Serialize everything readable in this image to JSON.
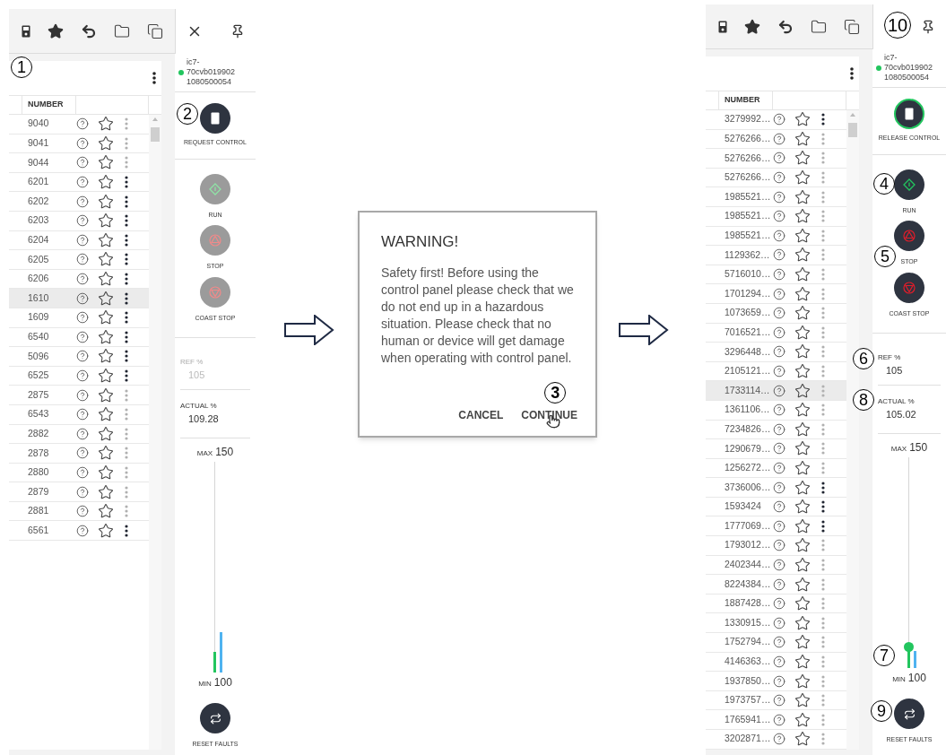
{
  "screens": [
    {
      "toolbar": {
        "callout": "1"
      },
      "device": {
        "lines": [
          "ic7-",
          "70cvb019902",
          "1080500054"
        ]
      },
      "control": {
        "label": "REQUEST CONTROL",
        "active": false,
        "callout": "2"
      },
      "commands": [
        {
          "kind": "run",
          "label": "RUN",
          "enabled": false
        },
        {
          "kind": "stop",
          "label": "STOP",
          "enabled": false
        },
        {
          "kind": "coast",
          "label": "COAST STOP",
          "enabled": false
        }
      ],
      "ref": {
        "label": "REF %",
        "value": "105",
        "enabled": false
      },
      "actual": {
        "label": "ACTUAL %",
        "value": "109.28"
      },
      "gauge": {
        "max_label": "MAX",
        "max_value": "150",
        "min_label": "MIN",
        "min_value": "100",
        "ref_bar": {
          "level": 0.1
        },
        "actual_bar": {
          "level": 0.19
        },
        "thumb": false
      },
      "reset": {
        "label": "RESET FAULTS"
      },
      "table": {
        "column": "NUMBER",
        "rows": [
          {
            "number": "9040",
            "selected": false,
            "menu_enabled": false
          },
          {
            "number": "9041",
            "selected": false,
            "menu_enabled": false
          },
          {
            "number": "9044",
            "selected": false,
            "menu_enabled": false
          },
          {
            "number": "6201",
            "selected": false,
            "menu_enabled": true
          },
          {
            "number": "6202",
            "selected": false,
            "menu_enabled": true
          },
          {
            "number": "6203",
            "selected": false,
            "menu_enabled": true
          },
          {
            "number": "6204",
            "selected": false,
            "menu_enabled": true
          },
          {
            "number": "6205",
            "selected": false,
            "menu_enabled": true
          },
          {
            "number": "6206",
            "selected": false,
            "menu_enabled": true
          },
          {
            "number": "1610",
            "selected": true,
            "menu_enabled": true
          },
          {
            "number": "1609",
            "selected": false,
            "menu_enabled": true
          },
          {
            "number": "6540",
            "selected": false,
            "menu_enabled": true
          },
          {
            "number": "5096",
            "selected": false,
            "menu_enabled": true
          },
          {
            "number": "6525",
            "selected": false,
            "menu_enabled": true
          },
          {
            "number": "2875",
            "selected": false,
            "menu_enabled": false
          },
          {
            "number": "6543",
            "selected": false,
            "menu_enabled": false
          },
          {
            "number": "2882",
            "selected": false,
            "menu_enabled": false
          },
          {
            "number": "2878",
            "selected": false,
            "menu_enabled": false
          },
          {
            "number": "2880",
            "selected": false,
            "menu_enabled": false
          },
          {
            "number": "2879",
            "selected": false,
            "menu_enabled": false
          },
          {
            "number": "2881",
            "selected": false,
            "menu_enabled": false
          },
          {
            "number": "6561",
            "selected": false,
            "menu_enabled": true
          }
        ]
      }
    },
    {
      "close": {
        "callout": "10"
      },
      "device": {
        "lines": [
          "ic7-",
          "70cvb019902",
          "1080500054"
        ]
      },
      "control": {
        "label": "RELEASE CONTROL",
        "active": true
      },
      "commands": [
        {
          "kind": "run",
          "label": "RUN",
          "enabled": true,
          "callout": "4"
        },
        {
          "kind": "stop",
          "label": "STOP",
          "enabled": true,
          "callout": "5"
        },
        {
          "kind": "coast",
          "label": "COAST STOP",
          "enabled": true
        }
      ],
      "ref": {
        "label": "REF %",
        "value": "105",
        "enabled": true,
        "callout": "6"
      },
      "actual": {
        "label": "ACTUAL %",
        "value": "105.02",
        "callout": "8"
      },
      "gauge": {
        "max_label": "MAX",
        "max_value": "150",
        "min_label": "MIN",
        "min_value": "100",
        "ref_bar": {
          "level": 0.1
        },
        "actual_bar": {
          "level": 0.08
        },
        "thumb": true,
        "callout": "7"
      },
      "reset": {
        "label": "RESET FAULTS",
        "callout": "9"
      },
      "table": {
        "column": "NUMBER",
        "rows": [
          {
            "number": "3279992…",
            "selected": false,
            "menu_enabled": true
          },
          {
            "number": "5276266…",
            "selected": false,
            "menu_enabled": false
          },
          {
            "number": "5276266…",
            "selected": false,
            "menu_enabled": false
          },
          {
            "number": "5276266…",
            "selected": false,
            "menu_enabled": false
          },
          {
            "number": "1985521…",
            "selected": false,
            "menu_enabled": false
          },
          {
            "number": "1985521…",
            "selected": false,
            "menu_enabled": false
          },
          {
            "number": "1985521…",
            "selected": false,
            "menu_enabled": false
          },
          {
            "number": "1129362…",
            "selected": false,
            "menu_enabled": false
          },
          {
            "number": "5716010…",
            "selected": false,
            "menu_enabled": false
          },
          {
            "number": "1701294…",
            "selected": false,
            "menu_enabled": false
          },
          {
            "number": "1073659…",
            "selected": false,
            "menu_enabled": false
          },
          {
            "number": "7016521…",
            "selected": false,
            "menu_enabled": false
          },
          {
            "number": "3296448…",
            "selected": false,
            "menu_enabled": false
          },
          {
            "number": "2105121…",
            "selected": false,
            "menu_enabled": false
          },
          {
            "number": "1733114…",
            "selected": true,
            "menu_enabled": false
          },
          {
            "number": "1361106…",
            "selected": false,
            "menu_enabled": false
          },
          {
            "number": "7234826…",
            "selected": false,
            "menu_enabled": false
          },
          {
            "number": "1290679…",
            "selected": false,
            "menu_enabled": false
          },
          {
            "number": "1256272…",
            "selected": false,
            "menu_enabled": false
          },
          {
            "number": "3736006…",
            "selected": false,
            "menu_enabled": true
          },
          {
            "number": "1593424",
            "selected": false,
            "menu_enabled": true
          },
          {
            "number": "1777069…",
            "selected": false,
            "menu_enabled": true
          },
          {
            "number": "1793012…",
            "selected": false,
            "menu_enabled": false
          },
          {
            "number": "2402344…",
            "selected": false,
            "menu_enabled": false
          },
          {
            "number": "8224384…",
            "selected": false,
            "menu_enabled": false
          },
          {
            "number": "1887428…",
            "selected": false,
            "menu_enabled": false
          },
          {
            "number": "1330915…",
            "selected": false,
            "menu_enabled": false
          },
          {
            "number": "1752794…",
            "selected": false,
            "menu_enabled": false
          },
          {
            "number": "4146363…",
            "selected": false,
            "menu_enabled": false
          },
          {
            "number": "1937850…",
            "selected": false,
            "menu_enabled": false
          },
          {
            "number": "1973757…",
            "selected": false,
            "menu_enabled": false
          },
          {
            "number": "1765941…",
            "selected": false,
            "menu_enabled": false
          },
          {
            "number": "3202871…",
            "selected": false,
            "menu_enabled": false
          }
        ]
      }
    }
  ],
  "dialog": {
    "title": "WARNING!",
    "body": "Safety first! Before using the control panel please check that we do not end up in a hazardous situation. Please check that no human or device will get damage when operating with control panel.",
    "buttons": [
      {
        "label": "CANCEL",
        "hover": false
      },
      {
        "label": "CONTINUE",
        "hover": true,
        "callout": "3"
      }
    ]
  }
}
